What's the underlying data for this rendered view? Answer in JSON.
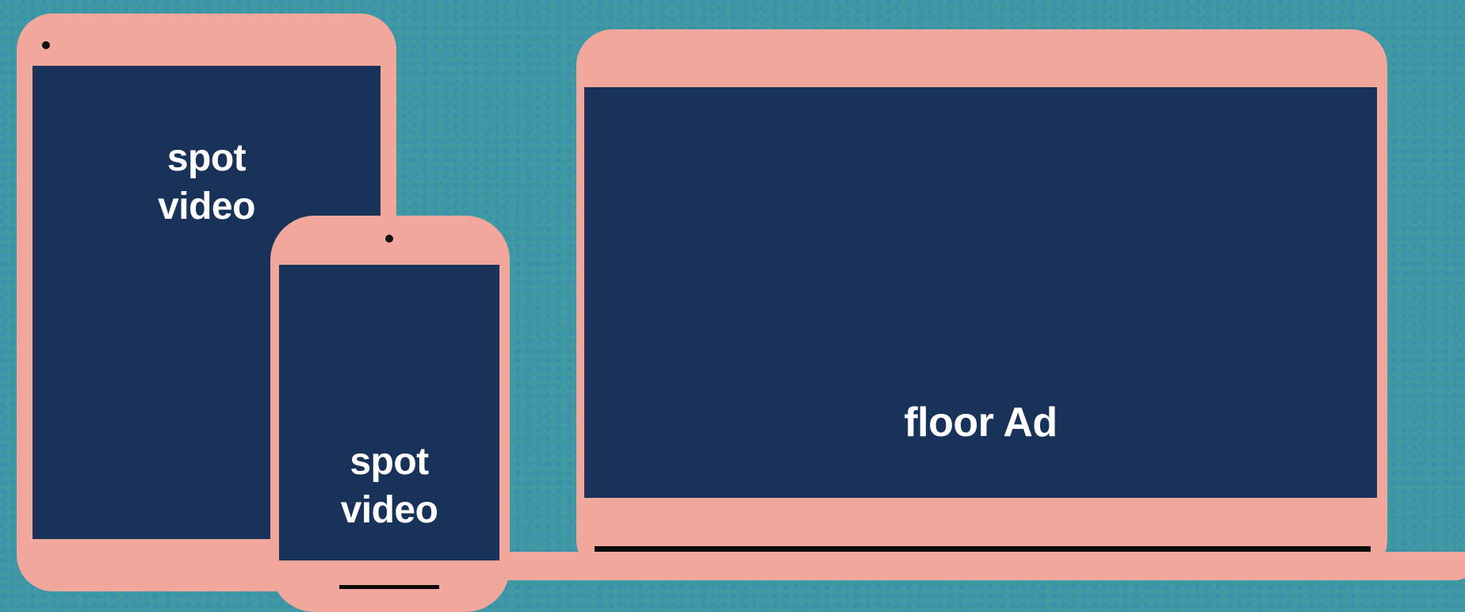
{
  "colors": {
    "background": "#3f9aa3",
    "device_body": "#f2a79c",
    "screen": "#18325a",
    "label_text": "#ffffff"
  },
  "tablet": {
    "screen_label_line1": "spot",
    "screen_label_line2": "video"
  },
  "phone": {
    "screen_label_line1": "spot",
    "screen_label_line2": "video"
  },
  "laptop": {
    "screen_label": "floor Ad"
  }
}
